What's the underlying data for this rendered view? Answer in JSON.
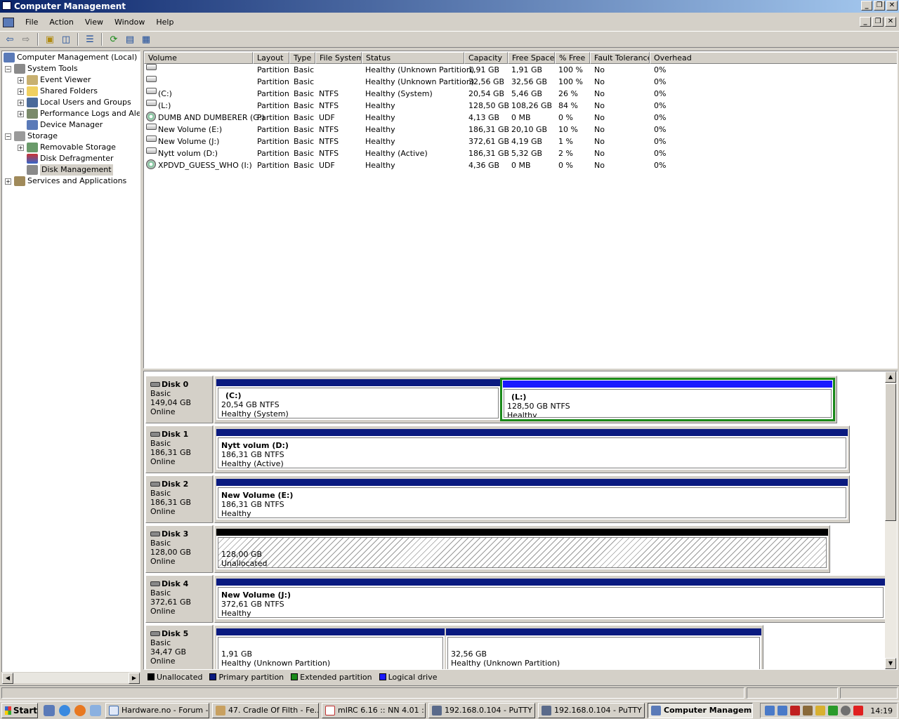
{
  "window": {
    "title": "Computer Management"
  },
  "menu": [
    "File",
    "Action",
    "View",
    "Window",
    "Help"
  ],
  "tree": {
    "root": "Computer Management (Local)",
    "system_tools": "System Tools",
    "event_viewer": "Event Viewer",
    "shared_folders": "Shared Folders",
    "local_users": "Local Users and Groups",
    "perf_logs": "Performance Logs and Alerts",
    "device_manager": "Device Manager",
    "storage": "Storage",
    "removable_storage": "Removable Storage",
    "disk_defrag": "Disk Defragmenter",
    "disk_management": "Disk Management",
    "services_apps": "Services and Applications"
  },
  "columns": [
    "Volume",
    "Layout",
    "Type",
    "File System",
    "Status",
    "Capacity",
    "Free Space",
    "% Free",
    "Fault Tolerance",
    "Overhead"
  ],
  "volumes": [
    {
      "icon": "drive",
      "name": "",
      "layout": "Partition",
      "type": "Basic",
      "fs": "",
      "status": "Healthy (Unknown Partition)",
      "capacity": "1,91 GB",
      "free": "1,91 GB",
      "pct": "100 %",
      "ft": "No",
      "overhead": "0%"
    },
    {
      "icon": "drive",
      "name": "",
      "layout": "Partition",
      "type": "Basic",
      "fs": "",
      "status": "Healthy (Unknown Partition)",
      "capacity": "32,56 GB",
      "free": "32,56 GB",
      "pct": "100 %",
      "ft": "No",
      "overhead": "0%"
    },
    {
      "icon": "drive",
      "name": "(C:)",
      "layout": "Partition",
      "type": "Basic",
      "fs": "NTFS",
      "status": "Healthy (System)",
      "capacity": "20,54 GB",
      "free": "5,46 GB",
      "pct": "26 %",
      "ft": "No",
      "overhead": "0%"
    },
    {
      "icon": "drive",
      "name": "(L:)",
      "layout": "Partition",
      "type": "Basic",
      "fs": "NTFS",
      "status": "Healthy",
      "capacity": "128,50 GB",
      "free": "108,26 GB",
      "pct": "84 %",
      "ft": "No",
      "overhead": "0%"
    },
    {
      "icon": "cd",
      "name": "DUMB AND DUMBERER (G:)",
      "layout": "Partition",
      "type": "Basic",
      "fs": "UDF",
      "status": "Healthy",
      "capacity": "4,13 GB",
      "free": "0 MB",
      "pct": "0 %",
      "ft": "No",
      "overhead": "0%"
    },
    {
      "icon": "drive",
      "name": "New Volume (E:)",
      "layout": "Partition",
      "type": "Basic",
      "fs": "NTFS",
      "status": "Healthy",
      "capacity": "186,31 GB",
      "free": "20,10 GB",
      "pct": "10 %",
      "ft": "No",
      "overhead": "0%"
    },
    {
      "icon": "drive",
      "name": "New Volume (J:)",
      "layout": "Partition",
      "type": "Basic",
      "fs": "NTFS",
      "status": "Healthy",
      "capacity": "372,61 GB",
      "free": "4,19 GB",
      "pct": "1 %",
      "ft": "No",
      "overhead": "0%"
    },
    {
      "icon": "drive",
      "name": "Nytt volum (D:)",
      "layout": "Partition",
      "type": "Basic",
      "fs": "NTFS",
      "status": "Healthy (Active)",
      "capacity": "186,31 GB",
      "free": "5,32 GB",
      "pct": "2 %",
      "ft": "No",
      "overhead": "0%"
    },
    {
      "icon": "cd",
      "name": "XPDVD_GUESS_WHO (I:)",
      "layout": "Partition",
      "type": "Basic",
      "fs": "UDF",
      "status": "Healthy",
      "capacity": "4,36 GB",
      "free": "0 MB",
      "pct": "0 %",
      "ft": "No",
      "overhead": "0%"
    }
  ],
  "disks": [
    {
      "name": "Disk 0",
      "type": "Basic",
      "size": "149,04 GB",
      "state": "Online"
    },
    {
      "name": "Disk 1",
      "type": "Basic",
      "size": "186,31 GB",
      "state": "Online"
    },
    {
      "name": "Disk 2",
      "type": "Basic",
      "size": "186,31 GB",
      "state": "Online"
    },
    {
      "name": "Disk 3",
      "type": "Basic",
      "size": "128,00 GB",
      "state": "Online"
    },
    {
      "name": "Disk 4",
      "type": "Basic",
      "size": "372,61 GB",
      "state": "Online"
    },
    {
      "name": "Disk 5",
      "type": "Basic",
      "size": "34,47 GB",
      "state": "Online"
    }
  ],
  "partitions": {
    "d0p0": {
      "title": "(C:)",
      "size": "20,54 GB NTFS",
      "status": "Healthy (System)"
    },
    "d0p1": {
      "title": "(L:)",
      "size": "128,50 GB NTFS",
      "status": "Healthy"
    },
    "d1p0": {
      "title": "Nytt volum  (D:)",
      "size": "186,31 GB NTFS",
      "status": "Healthy (Active)"
    },
    "d2p0": {
      "title": "New Volume  (E:)",
      "size": "186,31 GB NTFS",
      "status": "Healthy"
    },
    "d3p0": {
      "title": "",
      "size": "128,00 GB",
      "status": "Unallocated"
    },
    "d4p0": {
      "title": "New Volume  (J:)",
      "size": "372,61 GB NTFS",
      "status": "Healthy"
    },
    "d5p0": {
      "title": "",
      "size": "1,91 GB",
      "status": "Healthy (Unknown Partition)"
    },
    "d5p1": {
      "title": "",
      "size": "32,56 GB",
      "status": "Healthy (Unknown Partition)"
    }
  },
  "legend": [
    {
      "label": "Unallocated",
      "color": "#000000"
    },
    {
      "label": "Primary partition",
      "color": "#0a1a80"
    },
    {
      "label": "Extended partition",
      "color": "#1a8a1a"
    },
    {
      "label": "Logical drive",
      "color": "#1a1aff"
    }
  ],
  "taskbar": {
    "start": "Start",
    "items": [
      "Hardware.no - Forum -...",
      "47. Cradle Of Filth - Fe...",
      "mIRC 6.16 :: NN 4.01 :...",
      "192.168.0.104 - PuTTY",
      "192.168.0.104 - PuTTY",
      "Computer Managem..."
    ],
    "clock": "14:19"
  }
}
